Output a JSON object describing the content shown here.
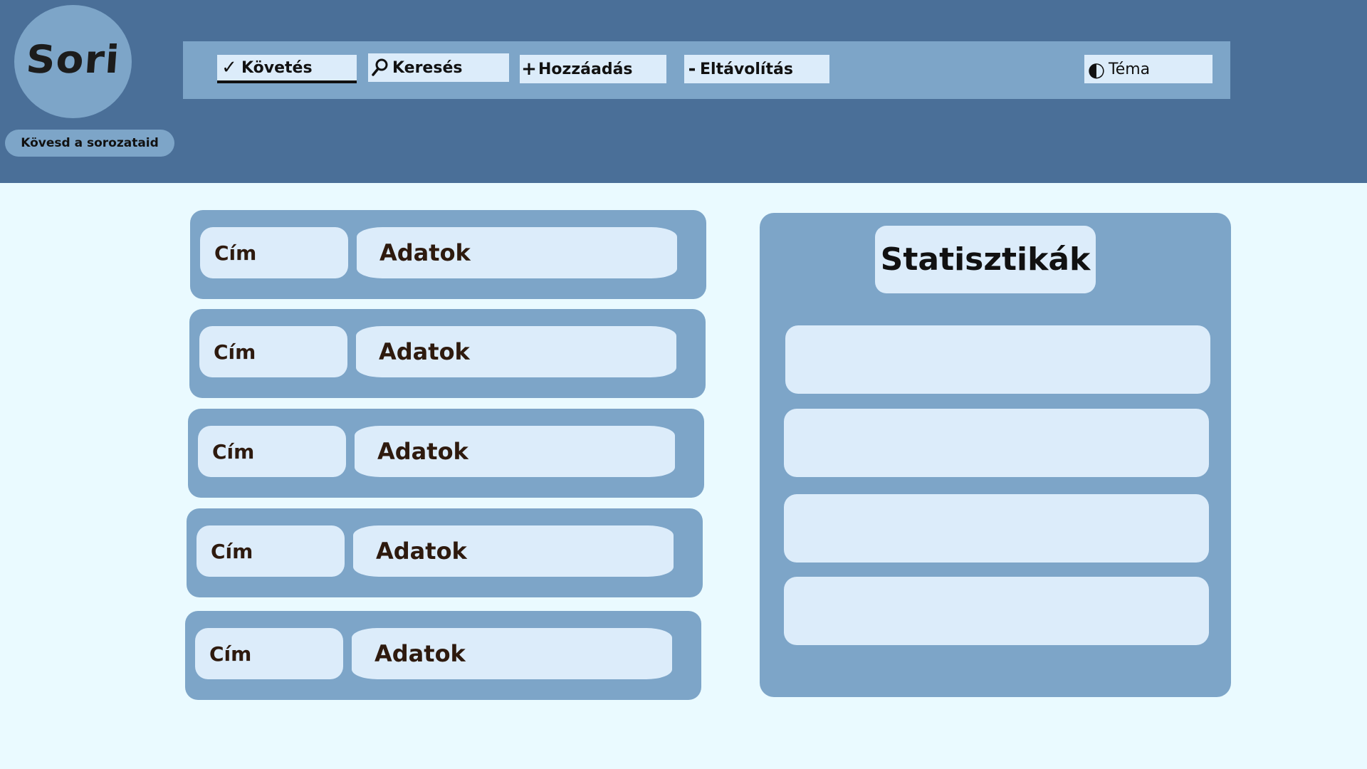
{
  "app": {
    "logo_text": "Sori",
    "tagline": "Kövesd a sorozataid"
  },
  "nav": {
    "follow": {
      "icon": "check-icon",
      "glyph": "✓",
      "label": "Követés"
    },
    "search": {
      "icon": "search-icon",
      "glyph": "⚲",
      "label": "Keresés"
    },
    "add": {
      "icon": "plus-icon",
      "glyph": "+",
      "label": "Hozzáadás"
    },
    "remove": {
      "icon": "minus-icon",
      "glyph": "-",
      "label": "Eltávolítás"
    },
    "theme": {
      "icon": "contrast-icon",
      "glyph": "◐",
      "label": "Téma"
    }
  },
  "series": [
    {
      "title": "Cím",
      "data": "Adatok"
    },
    {
      "title": "Cím",
      "data": "Adatok"
    },
    {
      "title": "Cím",
      "data": "Adatok"
    },
    {
      "title": "Cím",
      "data": "Adatok"
    },
    {
      "title": "Cím",
      "data": "Adatok"
    }
  ],
  "stats": {
    "title": "Statisztikák"
  },
  "colors": {
    "header": "#4a6f98",
    "panel": "#7da5c8",
    "card": "#dcecfa",
    "background": "#eafaff"
  }
}
